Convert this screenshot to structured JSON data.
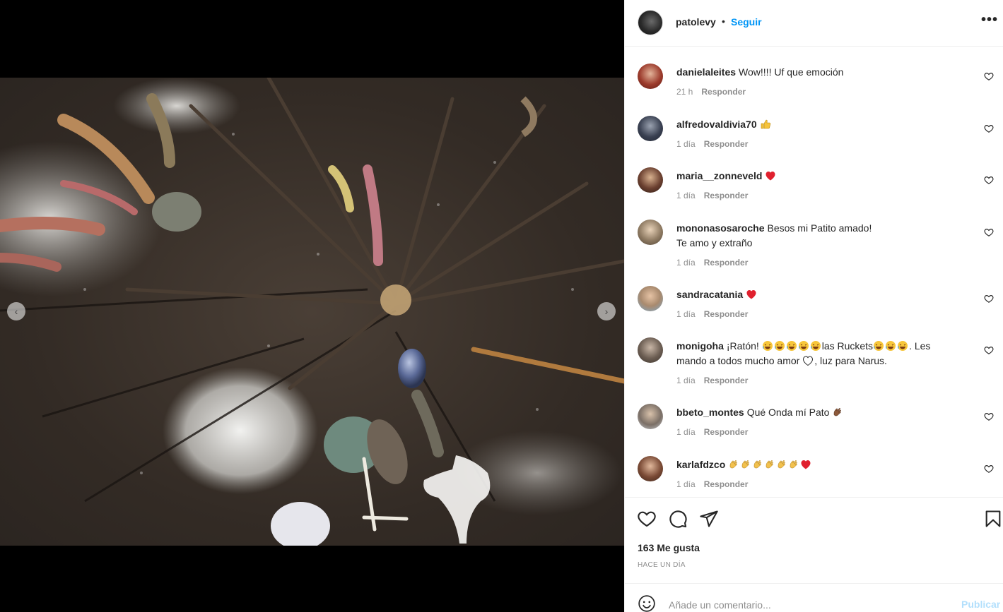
{
  "post": {
    "author": "patolevy",
    "separator": "•",
    "follow_label": "Seguir",
    "more_label": "•••"
  },
  "comments": [
    {
      "user": "danielaleites",
      "text": "Wow!!!! Uf que emoción",
      "emoji": [],
      "time": "21 h",
      "reply": "Responder"
    },
    {
      "user": "alfredovaldivia70",
      "text": "",
      "emoji": [
        "thumbs-up"
      ],
      "time": "1 día",
      "reply": "Responder"
    },
    {
      "user": "maria__zonneveld",
      "text": "",
      "emoji": [
        "red-heart"
      ],
      "time": "1 día",
      "reply": "Responder"
    },
    {
      "user": "mononasosaroche",
      "text": "Besos mi Patito amado!",
      "text2": "Te amo y extraño",
      "emoji": [],
      "time": "1 día",
      "reply": "Responder"
    },
    {
      "user": "sandracatania",
      "text": "",
      "emoji": [
        "red-heart"
      ],
      "time": "1 día",
      "reply": "Responder"
    },
    {
      "user": "monigoha",
      "text_a": "¡Ratón!",
      "text_b": "las Ruckets",
      "text_c": ". Les",
      "text2_a": "mando a todos mucho amor",
      "text2_b": ", luz para Narus.",
      "time": "1 día",
      "reply": "Responder"
    },
    {
      "user": "bbeto_montes",
      "text": "Qué Onda mí Pato",
      "emoji": [
        "clapping-hands"
      ],
      "time": "1 día",
      "reply": "Responder"
    },
    {
      "user": "karlafdzco",
      "text": "",
      "emoji": [
        "clapping-hands",
        "clapping-hands",
        "clapping-hands",
        "clapping-hands",
        "clapping-hands",
        "clapping-hands",
        "red-heart"
      ],
      "time": "1 día",
      "reply": "Responder"
    }
  ],
  "actions": {
    "likes": "163 Me gusta",
    "time_ago": "HACE UN DÍA"
  },
  "add_comment": {
    "placeholder": "Añade un comentario...",
    "publish_label": "Publicar"
  },
  "colors": {
    "accent": "#0095f6",
    "heart": "#ed4956",
    "muted": "#8e8e8e",
    "publish_disabled": "#b2dffc"
  }
}
